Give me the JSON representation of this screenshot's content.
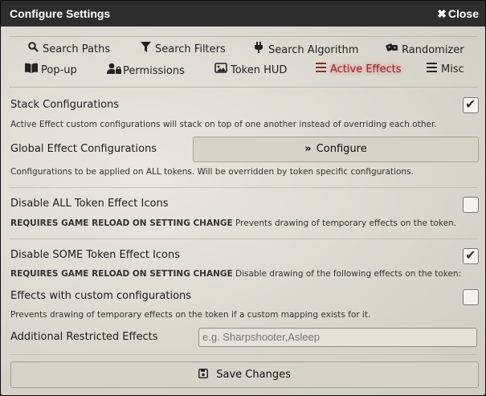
{
  "window": {
    "title": "Configure Settings",
    "close_label": "Close"
  },
  "tabs": [
    {
      "label": "Search Paths",
      "icon": "search-icon"
    },
    {
      "label": "Search Filters",
      "icon": "filter-icon"
    },
    {
      "label": "Search Algorithm",
      "icon": "plug-icon"
    },
    {
      "label": "Randomizer",
      "icon": "dice-icon"
    },
    {
      "label": "Pop-up",
      "icon": "book-icon"
    },
    {
      "label": "Permissions",
      "icon": "user-lock-icon"
    },
    {
      "label": "Token HUD",
      "icon": "image-icon"
    },
    {
      "label": "Active Effects",
      "icon": "bars-icon",
      "active": true
    },
    {
      "label": "Misc",
      "icon": "bars-icon"
    }
  ],
  "settings": {
    "stack": {
      "label": "Stack Configurations",
      "hint": "Active Effect custom configurations will stack on top of one another instead of overriding each other.",
      "checked": true
    },
    "global": {
      "label": "Global Effect Configurations",
      "button_label": "Configure",
      "hint": "Configurations to be applied on ALL tokens. Will be overridden by token specific configurations."
    },
    "disable_all": {
      "label": "Disable ALL Token Effect Icons",
      "hint_bold": "REQUIRES GAME RELOAD ON SETTING CHANGE",
      "hint": " Prevents drawing of temporary effects on the token.",
      "checked": false
    },
    "disable_some": {
      "label": "Disable SOME Token Effect Icons",
      "hint_bold": "REQUIRES GAME RELOAD ON SETTING CHANGE",
      "hint": " Disable drawing of the following effects on the token:",
      "checked": true
    },
    "custom_configs": {
      "label": "Effects with custom configurations",
      "hint": "Prevents drawing of temporary effects on the token if a custom mapping exists for it.",
      "checked": false
    },
    "restricted": {
      "label": "Additional Restricted Effects",
      "placeholder": "e.g. Sharpshooter,Asleep",
      "value": ""
    }
  },
  "footer": {
    "save_label": "Save Changes"
  },
  "colors": {
    "titlebar": "#2d2d2d",
    "active_tab": "#8a2a2a",
    "background": "#dedcd3"
  }
}
